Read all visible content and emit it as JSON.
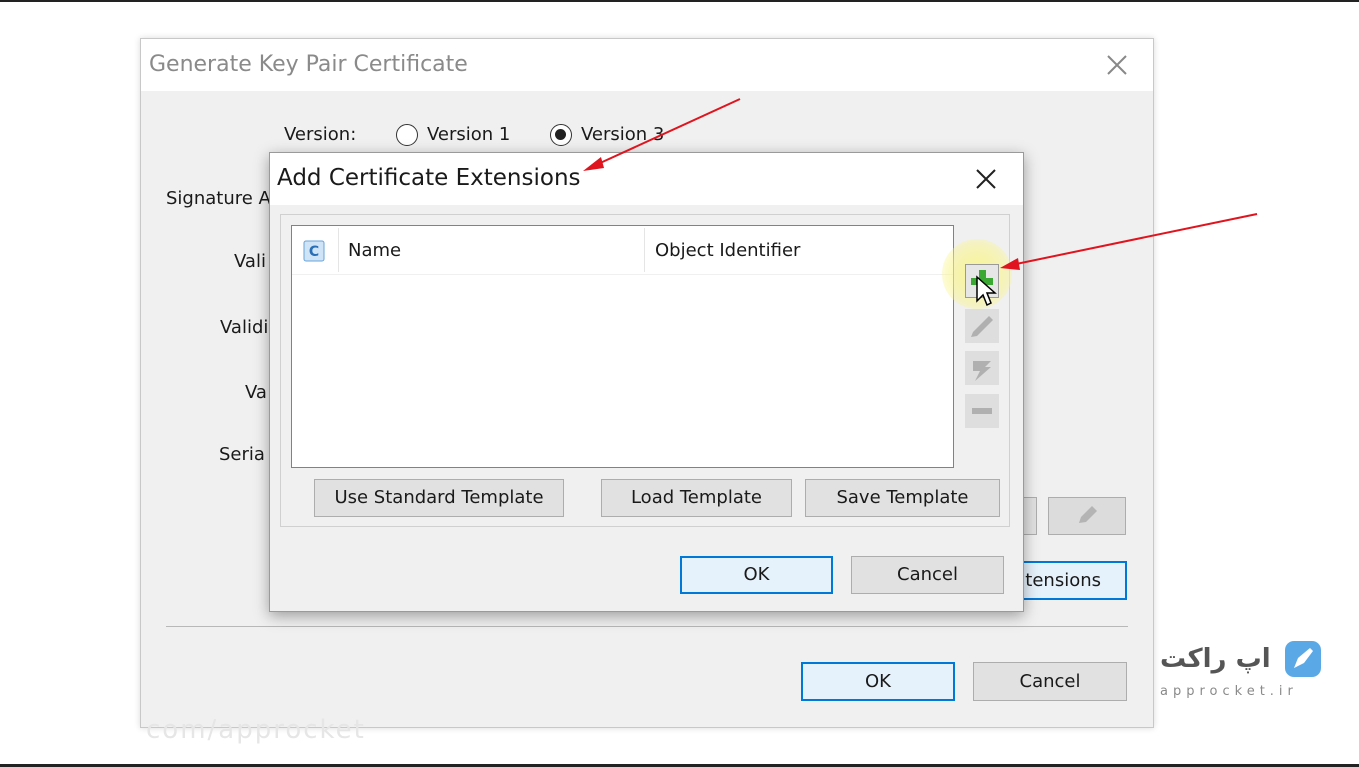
{
  "outer_dialog": {
    "title": "Generate Key Pair Certificate",
    "version_label": "Version:",
    "version_options": [
      {
        "label": "Version 1",
        "checked": false
      },
      {
        "label": "Version 3",
        "checked": true
      }
    ],
    "field_labels": [
      "Signature A",
      "Vali",
      "Validi",
      "Va",
      "Seria"
    ],
    "extensions_button_label": "tensions",
    "ok_label": "OK",
    "cancel_label": "Cancel",
    "watermark": "com/approcket"
  },
  "inner_dialog": {
    "title": "Add Certificate Extensions",
    "table": {
      "columns": [
        "Name",
        "Object Identifier"
      ],
      "rows": []
    },
    "toolbar_icons": [
      "add-extension-icon",
      "edit-extension-icon",
      "toggle-critical-icon",
      "remove-extension-icon"
    ],
    "template_buttons": {
      "use_standard": "Use Standard Template",
      "load": "Load Template",
      "save": "Save Template"
    },
    "ok_label": "OK",
    "cancel_label": "Cancel"
  },
  "branding": {
    "name": "اپ راکت",
    "url": "approcket.ir"
  },
  "colors": {
    "accent": "#0078d7",
    "arrow": "#e0141e",
    "highlight": "#f8f27a",
    "add_icon": "#3aa832"
  }
}
